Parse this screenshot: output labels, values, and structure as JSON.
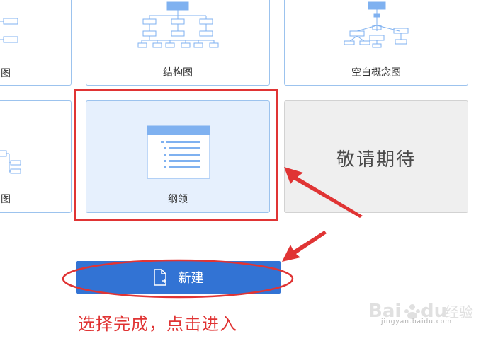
{
  "templates": {
    "row1": {
      "partial_left_label": "图",
      "structure_label": "结构图",
      "concept_label": "空白概念图"
    },
    "row2": {
      "partial_left_label": "图",
      "outline_label": "纲领",
      "coming_soon_text": "敬请期待"
    }
  },
  "new_button": {
    "label": "新建",
    "icon": "new-file-icon",
    "color": "#3273d4"
  },
  "annotation": {
    "instruction": "选择完成，点击进入",
    "color": "#e03434"
  },
  "watermark": {
    "brand": "Baidu经验",
    "url": "jingyan.baidu.com"
  },
  "colors": {
    "card_border": "#9cc3ee",
    "selected_card_bg": "#e6f0fd",
    "coming_soon_bg": "#efefef",
    "icon_blue": "#7fb1f0"
  }
}
